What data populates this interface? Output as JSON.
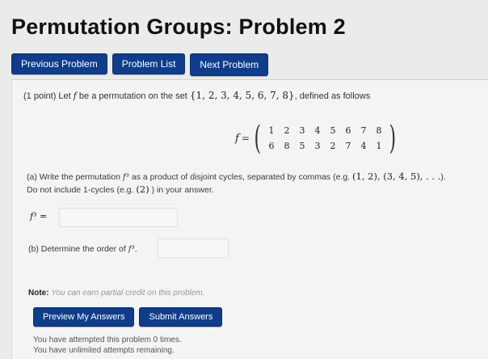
{
  "page": {
    "title": "Permutation Groups: Problem 2"
  },
  "nav": {
    "previous": "Previous Problem",
    "list": "Problem List",
    "next": "Next Problem"
  },
  "problem": {
    "points": "(1 point)",
    "intro_before": "Let",
    "f_symbol": "f",
    "intro_mid": "be a permutation on the set",
    "set": "{1, 2, 3, 4, 5, 6, 7, 8}",
    "intro_after": ", defined as follows",
    "perm_name": "f",
    "perm_eq": "=",
    "top_row": [
      "1",
      "2",
      "3",
      "4",
      "5",
      "6",
      "7",
      "8"
    ],
    "bottom_row": [
      "6",
      "8",
      "5",
      "3",
      "2",
      "7",
      "4",
      "1"
    ]
  },
  "part_a": {
    "prefix": "(a) Write the permutation",
    "f3": "f³",
    "mid": "as a product of disjoint cycles, separated by commas (e.g.",
    "example1": "(1, 2), (3, 4, 5), . . .",
    "end1": ").",
    "line2_prefix": "Do not include 1-cycles (e.g.",
    "example2": "(2)",
    "line2_end": ") in your answer.",
    "answer_label": "f³ =",
    "answer_value": ""
  },
  "part_b": {
    "prefix": "(b) Determine the order of",
    "f3": "f³",
    "end": ".",
    "answer_value": ""
  },
  "note": {
    "label": "Note:",
    "text": "You can earn partial credit on this problem."
  },
  "actions": {
    "preview": "Preview My Answers",
    "submit": "Submit Answers"
  },
  "status": {
    "line1": "You have attempted this problem 0 times.",
    "line2": "You have unlimited attempts remaining."
  },
  "colors": {
    "button": "#0f3d8c",
    "background": "#ebebea",
    "panel": "#f3f4f3"
  }
}
